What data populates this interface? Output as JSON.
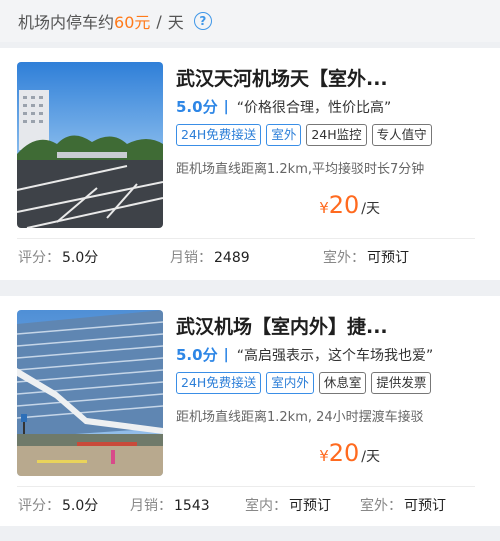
{
  "header": {
    "prefix": "机场内停车约",
    "price": "60元",
    "separator": "/",
    "unit": "天",
    "help_icon": "?"
  },
  "listings": [
    {
      "title": "武汉天河机场天【室外...",
      "score": "5.0分",
      "bar": "|",
      "quote": "“价格很合理，性价比高”",
      "tags": [
        {
          "label": "24H免费接送",
          "style": "blue"
        },
        {
          "label": "室外",
          "style": "blue"
        },
        {
          "label": "24H监控",
          "style": "gray"
        },
        {
          "label": "专人值守",
          "style": "gray"
        }
      ],
      "distance": "距机场直线距离1.2km,平均接驳时长7分钟",
      "price_symbol": "¥",
      "price": "20",
      "price_unit": "/天",
      "stats": [
        {
          "label": "评分：",
          "value": "5.0分"
        },
        {
          "label": "月销：",
          "value": "2489"
        },
        {
          "label": "室外：",
          "value": "可预订"
        }
      ]
    },
    {
      "title": "武汉机场【室内外】捷...",
      "score": "5.0分",
      "bar": "|",
      "quote": "“高启强表示，这个车场我也爱”",
      "tags": [
        {
          "label": "24H免费接送",
          "style": "blue"
        },
        {
          "label": "室内外",
          "style": "blue"
        },
        {
          "label": "休息室",
          "style": "gray"
        },
        {
          "label": "提供发票",
          "style": "gray"
        }
      ],
      "distance": "距机场直线距离1.2km, 24小时摆渡车接驳",
      "price_symbol": "¥",
      "price": "20",
      "price_unit": "/天",
      "stats": [
        {
          "label": "评分：",
          "value": "5.0分"
        },
        {
          "label": "月销：",
          "value": "1543"
        },
        {
          "label": "室内：",
          "value": "可预订"
        },
        {
          "label": "室外：",
          "value": "可预订"
        }
      ]
    }
  ],
  "colors": {
    "accent": "#2d86e6",
    "price": "#ff6a1f"
  }
}
